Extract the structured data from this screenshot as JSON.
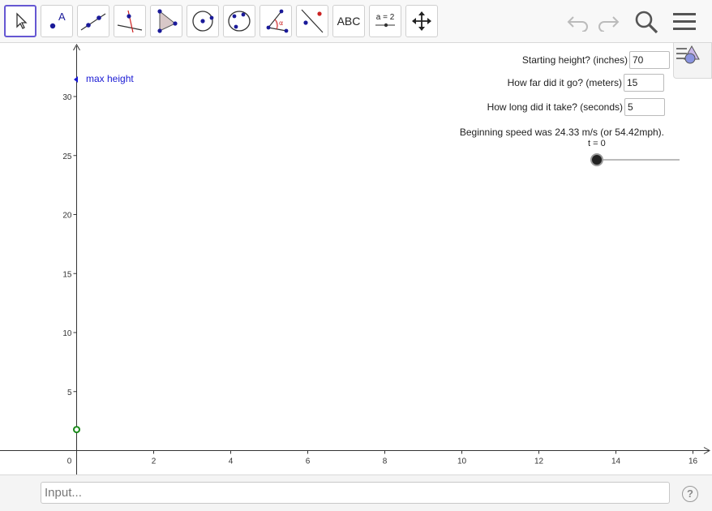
{
  "toolbar": {
    "tools": [
      {
        "name": "move",
        "icon": "cursor-arrow-icon"
      },
      {
        "name": "point",
        "icon": "point-icon",
        "glyph": "A"
      },
      {
        "name": "line",
        "icon": "line-icon"
      },
      {
        "name": "perpendicular",
        "icon": "perpendicular-line-icon"
      },
      {
        "name": "polygon",
        "icon": "polygon-icon"
      },
      {
        "name": "circle",
        "icon": "circle-center-icon"
      },
      {
        "name": "conic",
        "icon": "ellipse-icon"
      },
      {
        "name": "angle",
        "icon": "angle-icon",
        "glyph": "α"
      },
      {
        "name": "reflect",
        "icon": "reflect-line-icon"
      },
      {
        "name": "text",
        "icon": "text-icon",
        "label": "ABC"
      },
      {
        "name": "slider",
        "icon": "slider-icon",
        "label": "a = 2"
      },
      {
        "name": "move-view",
        "icon": "move-graphics-icon"
      }
    ],
    "right": [
      "undo-icon",
      "redo-icon",
      "search-icon",
      "menu-icon"
    ]
  },
  "graphics": {
    "inputs": [
      {
        "label": "Starting height? (inches)",
        "value": "70"
      },
      {
        "label": "How far did it go? (meters)",
        "value": "15"
      },
      {
        "label": "How long did it take? (seconds)",
        "value": "5"
      }
    ],
    "speed_text": "Beginning speed was 24.33 m/s (or 54.42mph).",
    "slider_label": "t = 0",
    "slider_value": 0,
    "max_height_label": "max height",
    "x_ticks": [
      "0",
      "2",
      "4",
      "6",
      "8",
      "10",
      "12",
      "14",
      "16"
    ],
    "y_ticks": [
      "5",
      "10",
      "15",
      "20",
      "25",
      "30"
    ],
    "point_y": 1.78,
    "colors": {
      "max_height": "#1a1ad4",
      "point": "#1a8a1a",
      "accent": "#6557d2"
    }
  },
  "input_bar": {
    "placeholder": "Input..."
  }
}
